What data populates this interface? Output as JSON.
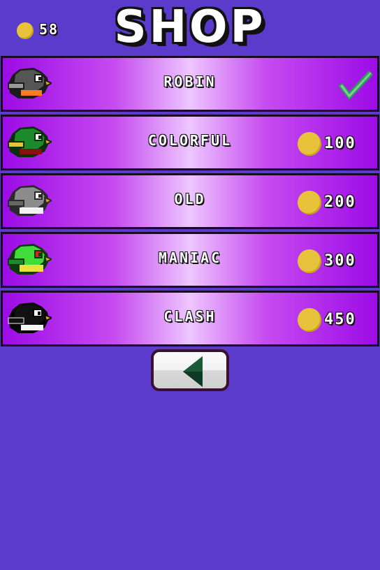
{
  "header": {
    "coin_balance": "58",
    "title": "SHOP"
  },
  "items": [
    {
      "name": "ROBIN",
      "price": "",
      "owned": true,
      "icon": "robin-bird-icon"
    },
    {
      "name": "COLORFUL",
      "price": "100",
      "owned": false,
      "icon": "colorful-bird-icon"
    },
    {
      "name": "OLD",
      "price": "200",
      "owned": false,
      "icon": "old-bird-icon"
    },
    {
      "name": "MANIAC",
      "price": "300",
      "owned": false,
      "icon": "maniac-bird-icon"
    },
    {
      "name": "CLASH",
      "price": "450",
      "owned": false,
      "icon": "clash-bird-icon"
    }
  ],
  "colors": {
    "background": "#5a3bcc",
    "row_gradient_edge": "#9c0be6",
    "row_gradient_center": "#eec6ff",
    "coin": "#e8c23a",
    "checkmark": "#2e9a5a"
  },
  "footer": {
    "back_icon": "back-arrow-icon"
  }
}
